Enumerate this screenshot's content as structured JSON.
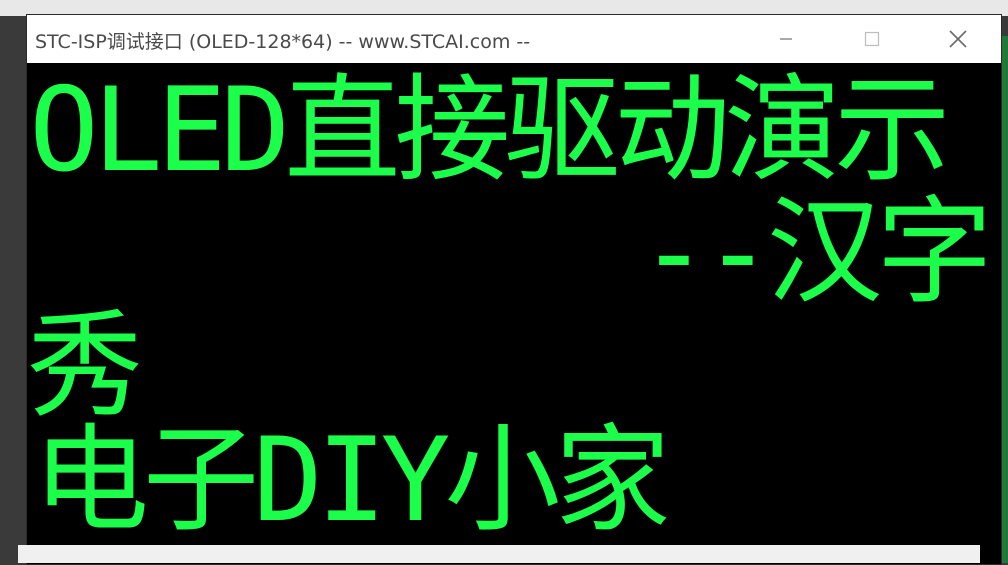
{
  "window": {
    "title": "STC-ISP调试接口 (OLED-128*64) -- www.STCAI.com --",
    "controls": {
      "minimize_icon": "minimize-icon",
      "maximize_icon": "maximize-icon",
      "close_icon": "close-icon"
    }
  },
  "oled": {
    "color": "#1cff4a",
    "lines": [
      "OLED直接驱动演示",
      "--汉字",
      "秀",
      "电子DIY小家"
    ]
  }
}
